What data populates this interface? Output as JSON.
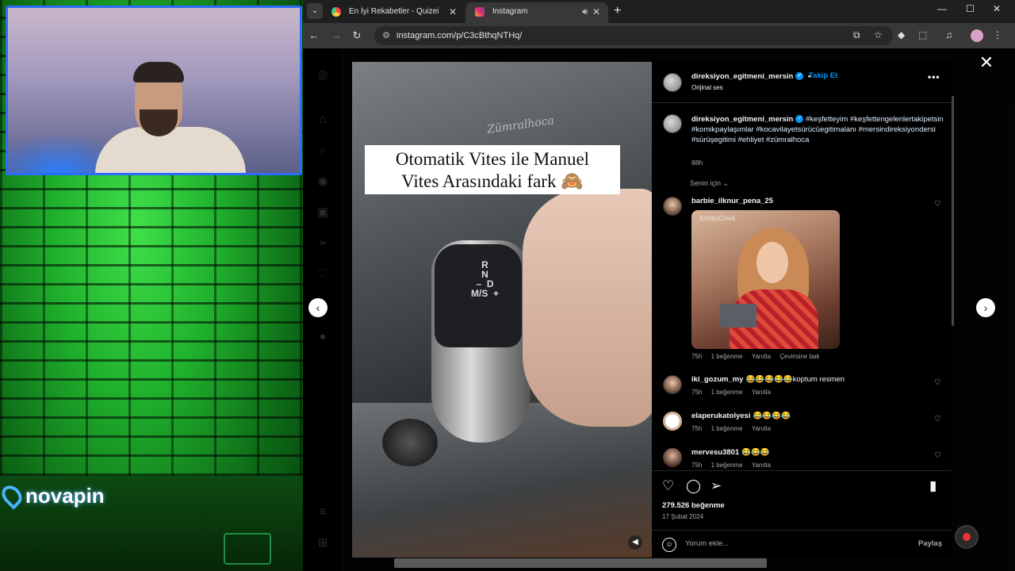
{
  "stream": {
    "brand_logo": "novapin"
  },
  "browser": {
    "tabs": [
      {
        "label": "En İyi Rekabetler - Quizei",
        "active": false
      },
      {
        "label": "Instagram",
        "active": true
      }
    ],
    "url": "instagram.com/p/C3cBthqNTHq/"
  },
  "post": {
    "video_caption_line1": "Otomatik Vites ile  Manuel",
    "video_caption_line2": "Vites Arasındaki fark 🙈",
    "video_watermark": "Zümralhoca",
    "gear_labels": "R\nN\n–  D\nM/S  +",
    "author": "direksiyon_egitmeni_mersin",
    "follow_label": "Takip Et",
    "audio": "Orijinal ses",
    "caption_author": "direksiyon_egitmeni_mersin",
    "caption_text": "#keşfetteyim #keşfettengelenlertakipetsin #komikpaylaşımlar #kocavilayetsürücüegitimalanı #mersindireksiyondersi #sürüşegitimi #ehliyet #zümralhoca",
    "caption_time": "88h",
    "for_you": "Senin için",
    "likes": "279.526 beğenme",
    "date": "17 Şubat 2024",
    "add_comment_placeholder": "Yorum ekle...",
    "share_label": "Paylaş"
  },
  "comments": [
    {
      "user": "barbie_ilknur_pena_25",
      "text": "",
      "time": "75h",
      "likes": "1 beğenme",
      "reply": "Yanıtla",
      "translate": "Çevirisine bak",
      "gif_tag": "SchittsCreek"
    },
    {
      "user": "iki_gozum_my",
      "text": "😂😂😂😂😂koptum resmen",
      "time": "75h",
      "likes": "1 beğenme",
      "reply": "Yanıtla"
    },
    {
      "user": "elaperukatolyesi",
      "text": "😂😂😂😂",
      "time": "75h",
      "likes": "1 beğenme",
      "reply": "Yanıtla"
    },
    {
      "user": "mervesu3801",
      "text": "😂😂😂",
      "time": "75h",
      "likes": "1 beğenme",
      "reply": "Yanıtla"
    }
  ],
  "icons": [
    "instagram-icon",
    "home-icon",
    "search-icon",
    "explore-icon",
    "reels-icon",
    "messages-icon",
    "notifications-icon",
    "menu-icon",
    "threads-icon",
    "heart-icon",
    "comment-icon",
    "share-icon",
    "bookmark-icon",
    "emoji-icon",
    "close-icon",
    "chevron-left-icon",
    "chevron-right-icon",
    "mute-icon"
  ],
  "colors": {
    "accent": "#0095f6",
    "panel_bg": "#000000",
    "notification": "#ff3040"
  }
}
